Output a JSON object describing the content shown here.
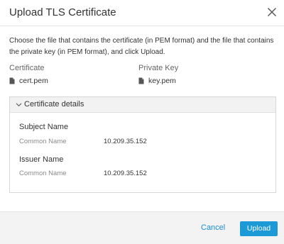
{
  "dialog": {
    "title": "Upload TLS Certificate",
    "description": "Choose the file that contains the certificate (in PEM format) and the file that contains the private key (in PEM format), and click Upload."
  },
  "files": {
    "certificate_label": "Certificate",
    "certificate_file": "cert.pem",
    "private_key_label": "Private Key",
    "private_key_file": "key.pem"
  },
  "details": {
    "title": "Certificate details",
    "expanded": true,
    "subject": {
      "section_title": "Subject Name",
      "field_label": "Common Name",
      "field_value": "10.209.35.152"
    },
    "issuer": {
      "section_title": "Issuer Name",
      "field_label": "Common Name",
      "field_value": "10.209.35.152"
    }
  },
  "footer": {
    "cancel_label": "Cancel",
    "upload_label": "Upload"
  },
  "icons": {
    "close": "close-icon",
    "file": "file-icon",
    "chevron": "chevron-down-icon"
  },
  "colors": {
    "accent": "#1c9ad8",
    "link": "#1a8fd6",
    "footer_bg": "#f3f3f3",
    "details_header_bg": "#f2f2f2"
  }
}
